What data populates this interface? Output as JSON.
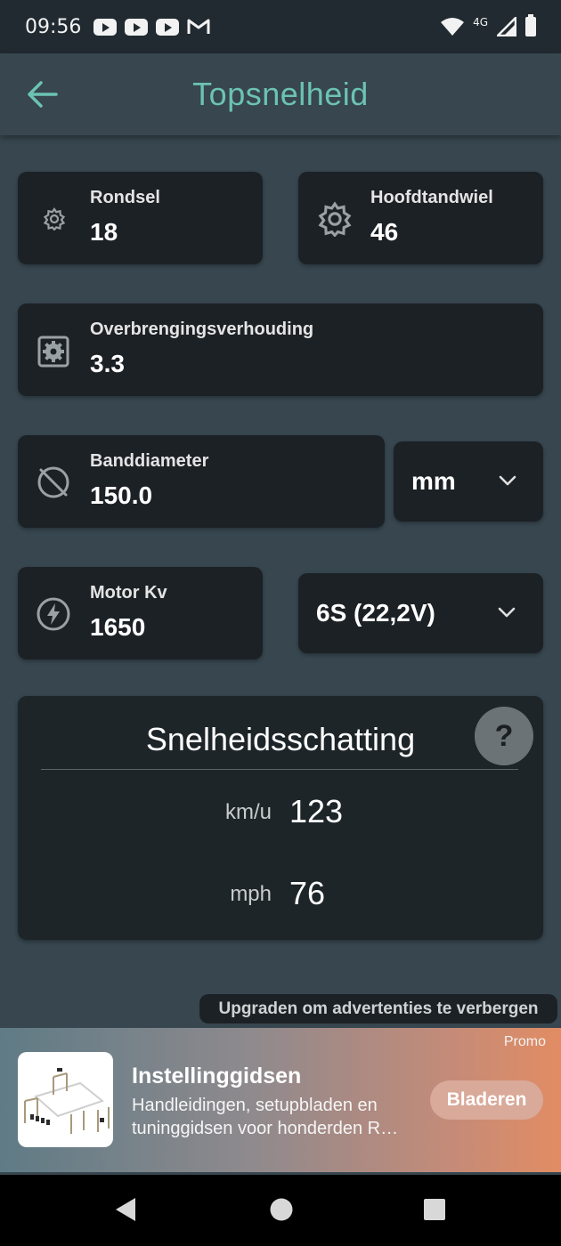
{
  "status_bar": {
    "time": "09:56",
    "notification_icons": [
      "youtube-icon",
      "youtube-icon",
      "youtube-icon",
      "gmail-icon"
    ],
    "network_label": "4G",
    "right_icons": [
      "wifi-icon",
      "signal-icon",
      "battery-icon"
    ]
  },
  "app_bar": {
    "title": "Topsnelheid",
    "back_icon": "arrow-left-icon",
    "accent_color": "#6cc3b2"
  },
  "fields": {
    "pinion": {
      "label": "Rondsel",
      "value": "18",
      "icon": "gear-small-icon"
    },
    "spur": {
      "label": "Hoofdtandwiel",
      "value": "46",
      "icon": "gear-icon"
    },
    "ratio": {
      "label": "Overbrengingsverhouding",
      "value": "3.3",
      "icon": "gearbox-icon"
    },
    "tire": {
      "label": "Banddiameter",
      "value": "150.0",
      "icon": "tire-off-icon"
    },
    "motor": {
      "label": "Motor Kv",
      "value": "1650",
      "icon": "lightning-icon"
    }
  },
  "dropdowns": {
    "tire_unit": {
      "value": "mm"
    },
    "battery": {
      "value": "6S (22,2V)"
    }
  },
  "result": {
    "title": "Snelheidsschatting",
    "help_label": "?",
    "rows": [
      {
        "unit": "km/u",
        "value": "123"
      },
      {
        "unit": "mph",
        "value": "76"
      }
    ]
  },
  "upgrade_text": "Upgraden om advertenties te verbergen",
  "ad": {
    "badge": "Promo",
    "title": "Instellinggidsen",
    "description_line1": "Handleidingen, setupbladen en",
    "description_line2": "tuninggidsen voor honderden R…",
    "button": "Bladeren"
  },
  "nav_bar": {
    "buttons": [
      "back-triangle-icon",
      "home-circle-icon",
      "recents-square-icon"
    ]
  }
}
